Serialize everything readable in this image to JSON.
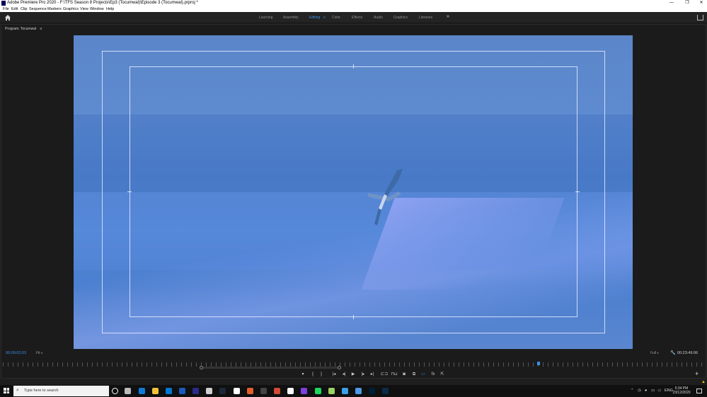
{
  "window": {
    "title": "Adobe Premiere Pro 2020 - F:\\TFS Season 8 Projects\\Ep3 (Tocumwal)\\Episode 3 (Tocumwal).prproj *",
    "minimize": "—",
    "maximize": "❐",
    "close": "✕"
  },
  "menu": [
    "File",
    "Edit",
    "Clip",
    "Sequence",
    "Markers",
    "Graphics",
    "View",
    "Window",
    "Help"
  ],
  "workspaces": {
    "items": [
      "Learning",
      "Assembly",
      "Editing",
      "Color",
      "Effects",
      "Audio",
      "Graphics",
      "Libraries"
    ],
    "active": "Editing",
    "active_menu_glyph": "≡",
    "more_glyph": "»"
  },
  "program_monitor": {
    "tab_label": "Program: Tocumwal",
    "tab_menu_glyph": "≡",
    "playhead_timecode": "00:09:02:03",
    "zoom_level": "Fit",
    "resolution": "Full",
    "duration_timecode": "00:23:49:06"
  },
  "transport": {
    "add_marker": "▾",
    "mark_in": "{",
    "mark_out": "}",
    "go_to_in": "|◂",
    "step_back": "◂|",
    "play": "▶",
    "step_forward": "|▸",
    "go_to_out": "▸|",
    "lift": "⊏⊐",
    "extract": "⊓⊔",
    "export_frame": "◙",
    "compare": "⧉",
    "safe_margins": "▭",
    "fx": "fx",
    "multicam": "⇱",
    "add_button": "+"
  },
  "taskbar": {
    "search_placeholder": "Type here to search",
    "language": "ENG",
    "time": "5:34 PM",
    "date": "23/12/2020",
    "pinned_colors": [
      "#ffffff",
      "#bbbbbb",
      "#0f7ad8",
      "#f0c237",
      "#0078d4",
      "#185abd",
      "#2b2b8a",
      "#cfcfcf",
      "#1b2838",
      "#ffffff",
      "#e25f2d",
      "#444444",
      "#d24b33",
      "#ffffff",
      "#7d3ee0",
      "#1ed760",
      "#9bd15e",
      "#3aa0e8",
      "#4b9be6",
      "#001e36",
      "#0c2b4b"
    ]
  }
}
